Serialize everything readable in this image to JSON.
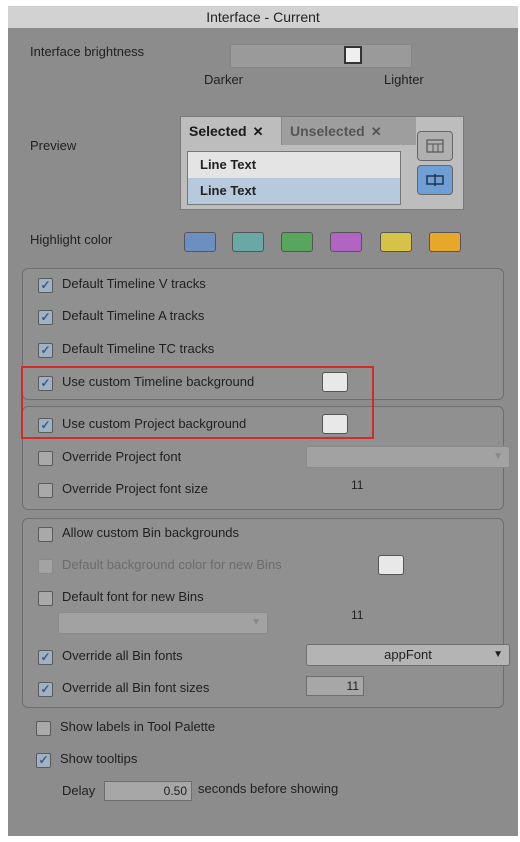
{
  "window": {
    "title": "Interface - Current"
  },
  "brightness": {
    "label": "Interface brightness",
    "min_label": "Darker",
    "max_label": "Lighter",
    "value": 0.7
  },
  "preview": {
    "label": "Preview",
    "tabs": [
      {
        "label": "Selected",
        "close": "✕"
      },
      {
        "label": "Unselected",
        "close": "✕"
      }
    ],
    "lines": [
      "Line Text",
      "Line Text"
    ]
  },
  "highlight": {
    "label": "Highlight color",
    "colors": [
      "#6d8fc0",
      "#6aa8a6",
      "#58a55e",
      "#b165c2",
      "#d6c246",
      "#e6a72a"
    ]
  },
  "timeline_group": {
    "v_tracks": "Default Timeline V tracks",
    "a_tracks": "Default Timeline A tracks",
    "tc_tracks": "Default Timeline TC tracks",
    "custom_timeline_bg": "Use custom Timeline background"
  },
  "project_group": {
    "custom_project_bg": "Use custom Project background",
    "override_font": "Override Project font",
    "override_font_size": "Override Project font size",
    "font_size_value": "11"
  },
  "bin_group": {
    "allow_custom_bg": "Allow custom Bin backgrounds",
    "default_bg_color": "Default background color for new Bins",
    "default_font": "Default font for new Bins",
    "default_font_size": "11",
    "override_all_fonts": "Override all Bin fonts",
    "font_dropdown_value": "appFont",
    "override_all_sizes": "Override all Bin font sizes",
    "size_field_value": "11"
  },
  "misc": {
    "show_labels": "Show labels in Tool Palette",
    "show_tooltips": "Show tooltips",
    "delay_label": "Delay",
    "delay_value": "0.50",
    "delay_suffix": "seconds before showing"
  },
  "colors": {
    "highlight_box": "#d42a2a",
    "check_blue": "#9fb1c5"
  }
}
